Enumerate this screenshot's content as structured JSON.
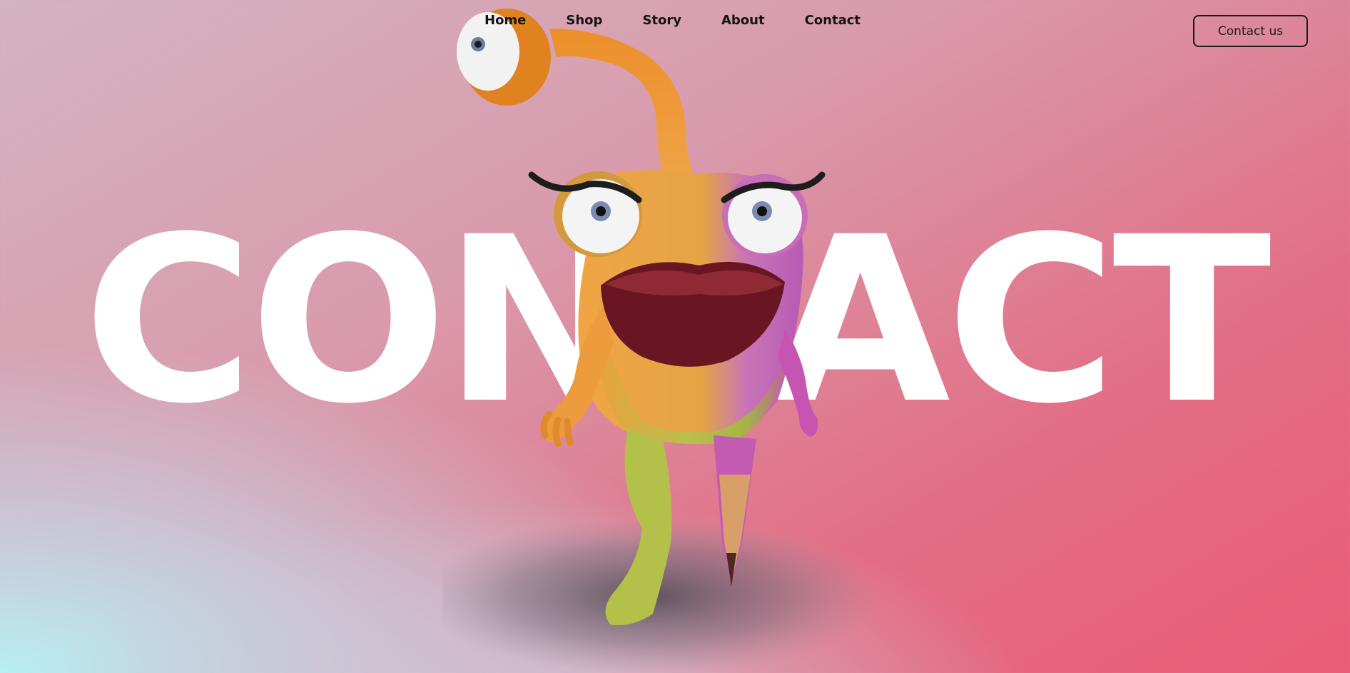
{
  "nav": {
    "links": [
      {
        "label": "Home"
      },
      {
        "label": "Shop"
      },
      {
        "label": "Story"
      },
      {
        "label": "About"
      },
      {
        "label": "Contact"
      }
    ],
    "cta_label": "Contact us"
  },
  "hero": {
    "title": "CONTACT"
  },
  "colors": {
    "accent": "#ea5d76",
    "cyan": "#b8eef4",
    "title_text": "#ffffff"
  }
}
